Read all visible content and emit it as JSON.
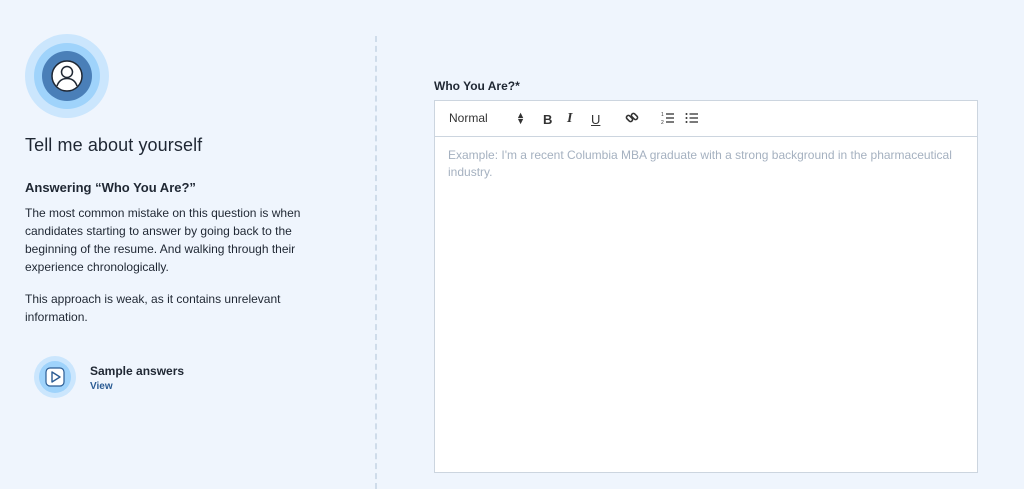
{
  "intro": {
    "title": "Tell me about yourself",
    "subtitle": "Answering “Who You Are?”",
    "paragraph1": "The most common mistake on this question is when candidates starting to answer by going back to the beginning of the resume. And walking through their experience chronologically.",
    "paragraph2": "This approach is weak, as it contains unrelevant information."
  },
  "sample": {
    "label": "Sample answers",
    "link": "View"
  },
  "form": {
    "field_label": "Who You Are?*",
    "placeholder": "Example: I'm a recent Columbia MBA graduate with a strong background in the pharmaceutical industry.",
    "value": ""
  },
  "toolbar": {
    "format_select": "Normal",
    "bold": "B",
    "italic": "I",
    "underline": "U"
  },
  "icons": {
    "avatar": "user-avatar-icon",
    "play": "play-icon",
    "link": "link-icon",
    "ordered_list": "ordered-list-icon",
    "bullet_list": "bullet-list-icon"
  },
  "colors": {
    "background": "#eff5fd",
    "accent_light": "#cbe6fd",
    "accent_mid": "#9fd3fb",
    "accent_dark": "#4a7fb8",
    "link": "#2b5c94"
  }
}
